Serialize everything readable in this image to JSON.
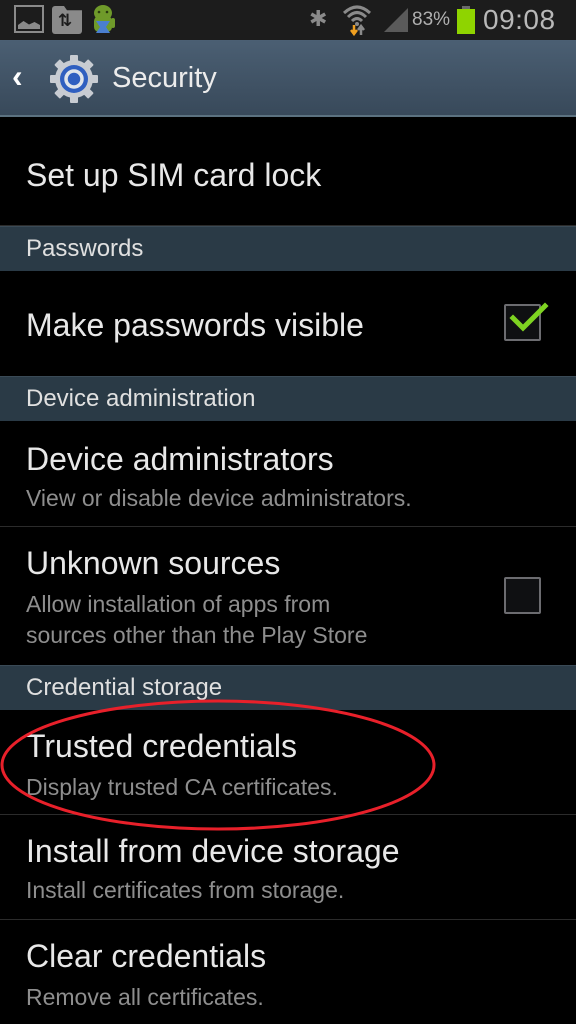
{
  "status_bar": {
    "icons": [
      "gallery-icon",
      "sync-folder-icon",
      "android-notification-icon",
      "bluetooth-icon",
      "wifi-icon",
      "cell-signal-icon",
      "battery-icon"
    ],
    "battery_percent": "83%",
    "time": "09:08",
    "battery_color": "#8fd400"
  },
  "action_bar": {
    "back_icon": "chevron-left-icon",
    "app_icon": "settings-gear-icon",
    "title": "Security"
  },
  "sections": {
    "sim": {
      "items": [
        {
          "title": "Set up SIM card lock"
        }
      ]
    },
    "passwords": {
      "header": "Passwords",
      "items": [
        {
          "title": "Make passwords visible",
          "checked": true
        }
      ]
    },
    "device_admin": {
      "header": "Device administration",
      "items": [
        {
          "title": "Device administrators",
          "summary": "View or disable device administrators."
        },
        {
          "title": "Unknown sources",
          "summary_line1": "Allow installation of apps from",
          "summary_line2": "sources other than the Play Store",
          "checked": false
        }
      ]
    },
    "credential_storage": {
      "header": "Credential storage",
      "items": [
        {
          "title": "Trusted credentials",
          "summary": "Display trusted CA certificates.",
          "highlighted": true
        },
        {
          "title": "Install from device storage",
          "summary": "Install certificates from storage."
        },
        {
          "title": "Clear credentials",
          "summary": "Remove all certificates."
        }
      ]
    }
  },
  "colors": {
    "accent_check": "#7ed321",
    "annotation": "#e8202a",
    "header_bg": "#2a3a46"
  }
}
